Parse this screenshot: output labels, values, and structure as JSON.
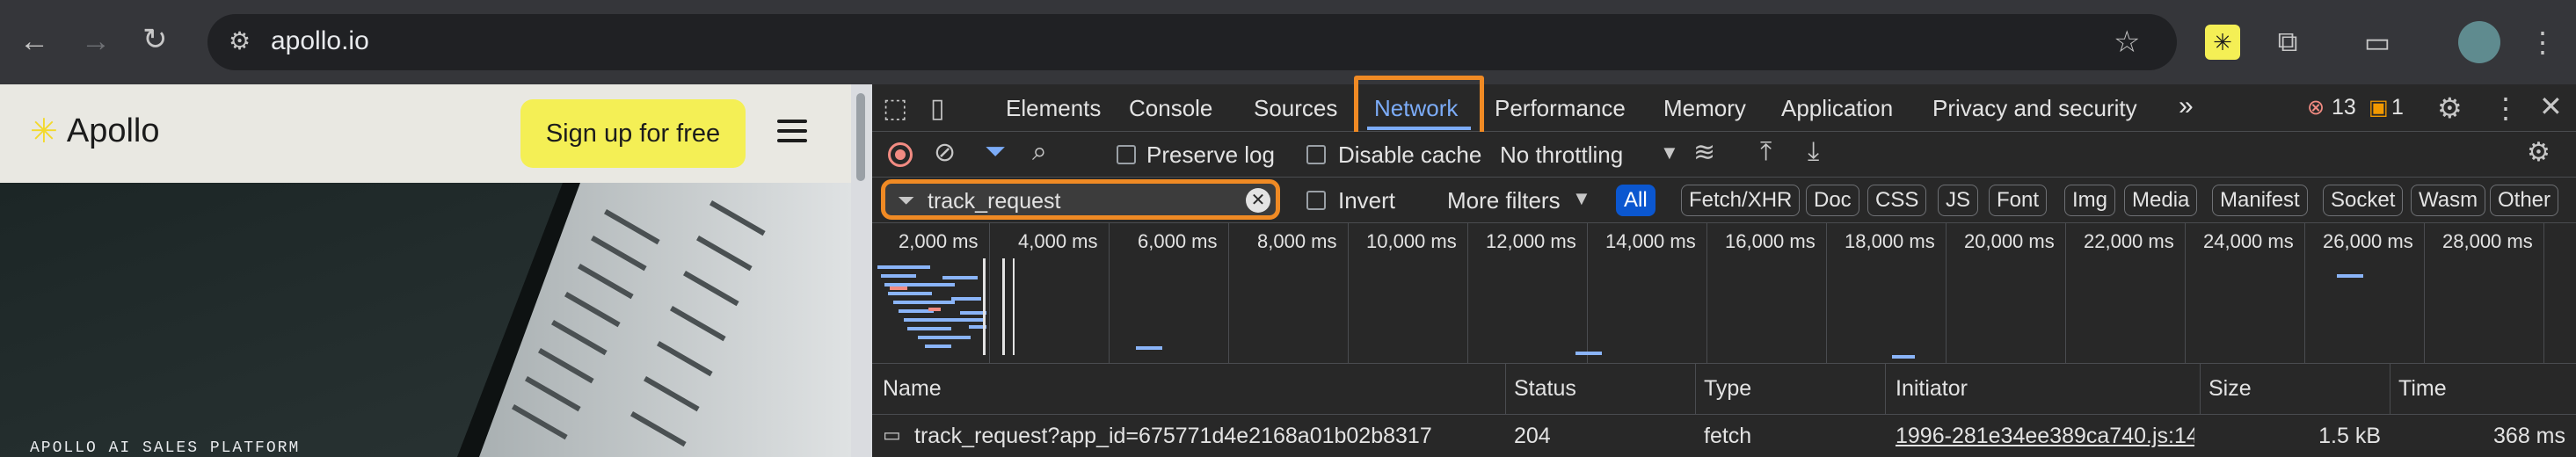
{
  "browser": {
    "url": "apollo.io",
    "icons": [
      "back-arrow-icon",
      "forward-arrow-icon",
      "reload-icon",
      "site-info-icon",
      "bookmark-star-icon",
      "extension-icon",
      "puzzle-icon",
      "cast-search-icon",
      "profile-avatar",
      "kebab-menu-icon"
    ]
  },
  "page": {
    "logo_text": "Apollo",
    "signup_label": "Sign up for free",
    "hero_tag": "APOLLO AI SALES PLATFORM",
    "brand_color": "#f4ef55"
  },
  "devtools": {
    "tabs": [
      "Elements",
      "Console",
      "Sources",
      "Network",
      "Performance",
      "Memory",
      "Application",
      "Privacy and security"
    ],
    "active_tab": "Network",
    "more_tabs": "»",
    "errors_count": "13",
    "warnings_count": "1",
    "toolbar": {
      "preserve_log": "Preserve log",
      "disable_cache": "Disable cache",
      "throttling": "No throttling"
    },
    "filter": {
      "value": "track_request",
      "invert": "Invert",
      "more_filters": "More filters",
      "types": [
        "All",
        "Fetch/XHR",
        "Doc",
        "CSS",
        "JS",
        "Font",
        "Img",
        "Media",
        "Manifest",
        "Socket",
        "Wasm",
        "Other"
      ]
    },
    "overview_ticks": [
      "2,000 ms",
      "4,000 ms",
      "6,000 ms",
      "8,000 ms",
      "10,000 ms",
      "12,000 ms",
      "14,000 ms",
      "16,000 ms",
      "18,000 ms",
      "20,000 ms",
      "22,000 ms",
      "24,000 ms",
      "26,000 ms",
      "28,000 ms"
    ],
    "columns": [
      "Name",
      "Status",
      "Type",
      "Initiator",
      "Size",
      "Time"
    ],
    "rows": [
      {
        "name": "track_request?app_id=675771d4e2168a01b02b8317",
        "status": "204",
        "type": "fetch",
        "initiator": "1996-281e34ee389ca740.js:14",
        "size": "1.5 kB",
        "time": "368 ms"
      }
    ],
    "colors": {
      "highlight": "#f08a24",
      "accent": "#7cacf8",
      "error": "#f28b82",
      "warning": "#f29900"
    }
  }
}
